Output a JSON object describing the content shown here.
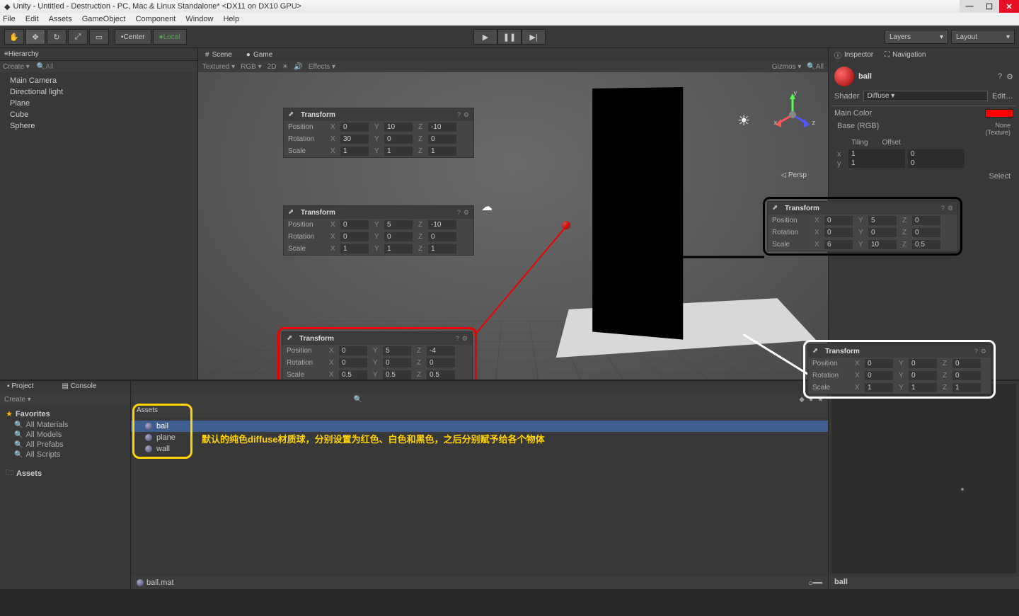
{
  "window_title": "Unity - Untitled - Destruction - PC, Mac & Linux Standalone* <DX11 on DX10 GPU>",
  "menus": {
    "file": "File",
    "edit": "Edit",
    "assets": "Assets",
    "gameobject": "GameObject",
    "component": "Component",
    "window": "Window",
    "help": "Help"
  },
  "toolbar": {
    "center": "Center",
    "local": "Local",
    "layers": "Layers",
    "layout": "Layout"
  },
  "hierarchy": {
    "title": "Hierarchy",
    "create": "Create",
    "search_placeholder": "All",
    "items": [
      "Main Camera",
      "Directional light",
      "Plane",
      "Cube",
      "Sphere"
    ]
  },
  "scene": {
    "tab_scene": "Scene",
    "tab_game": "Game",
    "toolbar": {
      "textured": "Textured",
      "rgb": "RGB",
      "twod": "2D",
      "effects": "Effects",
      "gizmos": "Gizmos",
      "search": "All"
    },
    "persp": "Persp",
    "axes": {
      "x": "x",
      "y": "y",
      "z": "z"
    }
  },
  "transforms": {
    "t1": {
      "title": "Transform",
      "pos": {
        "x": "0",
        "y": "10",
        "z": "-10"
      },
      "rot": {
        "x": "30",
        "y": "0",
        "z": "0"
      },
      "scale": {
        "x": "1",
        "y": "1",
        "z": "1"
      }
    },
    "t2": {
      "title": "Transform",
      "pos": {
        "x": "0",
        "y": "5",
        "z": "-10"
      },
      "rot": {
        "x": "0",
        "y": "0",
        "z": "0"
      },
      "scale": {
        "x": "1",
        "y": "1",
        "z": "1"
      }
    },
    "t3": {
      "title": "Transform",
      "pos": {
        "x": "0",
        "y": "5",
        "z": "-4"
      },
      "rot": {
        "x": "0",
        "y": "0",
        "z": "0"
      },
      "scale": {
        "x": "0.5",
        "y": "0.5",
        "z": "0.5"
      }
    },
    "t4": {
      "title": "Transform",
      "pos": {
        "x": "0",
        "y": "5",
        "z": "0"
      },
      "rot": {
        "x": "0",
        "y": "0",
        "z": "0"
      },
      "scale": {
        "x": "6",
        "y": "10",
        "z": "0.5"
      }
    },
    "t5": {
      "title": "Transform",
      "pos": {
        "x": "0",
        "y": "0",
        "z": "0"
      },
      "rot": {
        "x": "0",
        "y": "0",
        "z": "0"
      },
      "scale": {
        "x": "1",
        "y": "1",
        "z": "1"
      }
    },
    "row_labels": {
      "position": "Position",
      "rotation": "Rotation",
      "scale": "Scale",
      "x": "X",
      "y": "Y",
      "z": "Z"
    }
  },
  "inspector": {
    "tab_inspector": "Inspector",
    "tab_navigation": "Navigation",
    "material_name": "ball",
    "shader_label": "Shader",
    "shader_value": "Diffuse",
    "edit": "Edit…",
    "main_color": "Main Color",
    "base_rgb": "Base (RGB)",
    "none_texture": "None\n(Texture)",
    "tiling": "Tiling",
    "offset": "Offset",
    "tx": {
      "x": "1",
      "y": "1"
    },
    "ox": {
      "x": "0",
      "y": "0"
    },
    "select": "Select",
    "footer": "ball"
  },
  "project": {
    "tab_project": "Project",
    "tab_console": "Console",
    "create": "Create",
    "favorites": "Favorites",
    "fav_items": [
      "All Materials",
      "All Models",
      "All Prefabs",
      "All Scripts"
    ],
    "assets_folder": "Assets"
  },
  "assets": {
    "header": "Assets",
    "items": [
      "ball",
      "plane",
      "wall"
    ],
    "annotation": "默认的纯色diffuse材质球，分别设置为红色、白色和黑色，之后分别赋予给各个物体",
    "footer": "ball.mat"
  }
}
